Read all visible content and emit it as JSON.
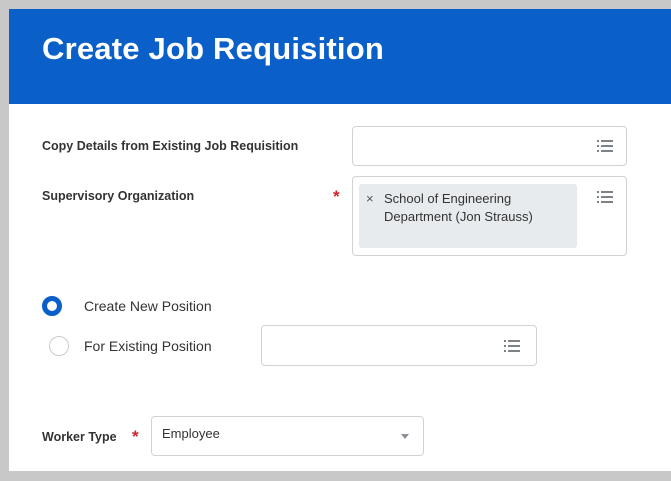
{
  "page": {
    "title": "Create Job Requisition"
  },
  "form": {
    "copy_details": {
      "label": "Copy Details from Existing Job Requisition",
      "value": ""
    },
    "supervisory_org": {
      "label": "Supervisory Organization",
      "required_mark": "*",
      "chip_remove": "×",
      "selected": "School of Engineering Department (Jon Strauss)"
    },
    "position_choice": {
      "options": [
        {
          "label": "Create New Position",
          "selected": true
        },
        {
          "label": "For Existing Position",
          "selected": false
        }
      ],
      "existing_position_value": ""
    },
    "worker_type": {
      "label": "Worker Type",
      "required_mark": "*",
      "value": "Employee"
    }
  },
  "icons": {
    "prompt": "list-icon",
    "dropdown": "chevron-down-icon"
  },
  "colors": {
    "header_bg": "#0b5fc8",
    "accent": "#0b5fc8",
    "required": "#d1232a",
    "chip_bg": "#e7ebee"
  }
}
